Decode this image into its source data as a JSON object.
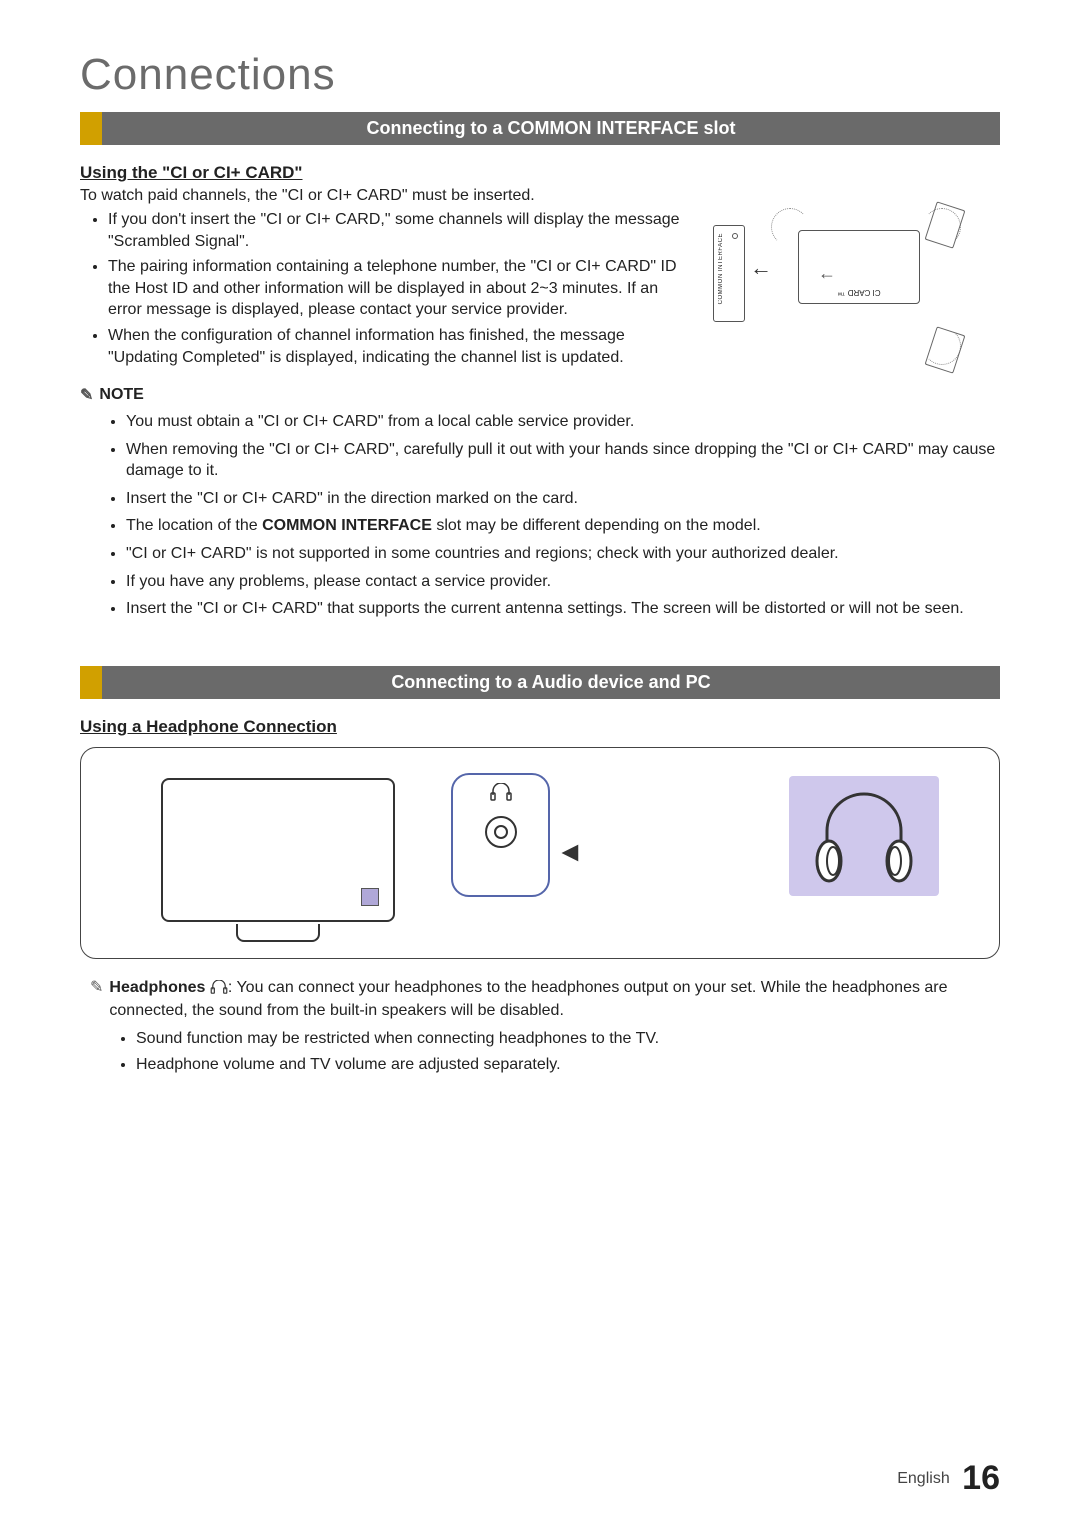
{
  "page_title": "Connections",
  "section1": {
    "heading": "Connecting to a COMMON INTERFACE slot",
    "subheading": "Using the \"CI or CI+ CARD\"",
    "intro": "To watch paid channels, the \"CI or CI+ CARD\" must be inserted.",
    "bullets": [
      "If you don't insert the \"CI or CI+ CARD,\" some channels will display the message \"Scrambled Signal\".",
      "The pairing information containing a telephone number, the \"CI or CI+ CARD\" ID the Host ID and other information will be displayed in about 2~3 minutes. If an error message is displayed, please contact your service provider.",
      "When the configuration of channel information has finished, the message \"Updating Completed\" is displayed, indicating the channel list is updated."
    ],
    "diagram": {
      "slot_label": "COMMON INTERFACE",
      "card_label": "CI CARD ™"
    },
    "note_label": "NOTE",
    "note_bullets": [
      "You must obtain a \"CI or CI+ CARD\" from a local cable service provider.",
      "When removing the \"CI or CI+ CARD\", carefully pull it out with your hands since dropping the \"CI or CI+ CARD\" may cause damage to it.",
      "Insert the \"CI or CI+ CARD\" in the direction marked on the card.",
      "The location of the COMMON INTERFACE slot may be different depending on the model.",
      "\"CI or CI+ CARD\" is not supported in some countries and regions; check with your authorized dealer.",
      "If you have any problems, please contact a service provider.",
      "Insert the \"CI or CI+ CARD\" that supports the current antenna settings. The screen will be distorted or will not be seen."
    ],
    "note_bullet_bold_idx": 3,
    "note_bullet_bold_text": "COMMON INTERFACE"
  },
  "section2": {
    "heading": "Connecting to a Audio device and PC",
    "subheading": "Using a Headphone Connection",
    "headphone_lead_bold": "Headphones",
    "headphone_lead_rest": ": You can connect your headphones to the headphones output on your set. While the headphones are connected, the sound from the built-in speakers will be disabled.",
    "sub_bullets": [
      "Sound function may be restricted when connecting headphones to the TV.",
      "Headphone volume and TV volume are adjusted separately."
    ]
  },
  "footer": {
    "lang": "English",
    "page": "16"
  }
}
